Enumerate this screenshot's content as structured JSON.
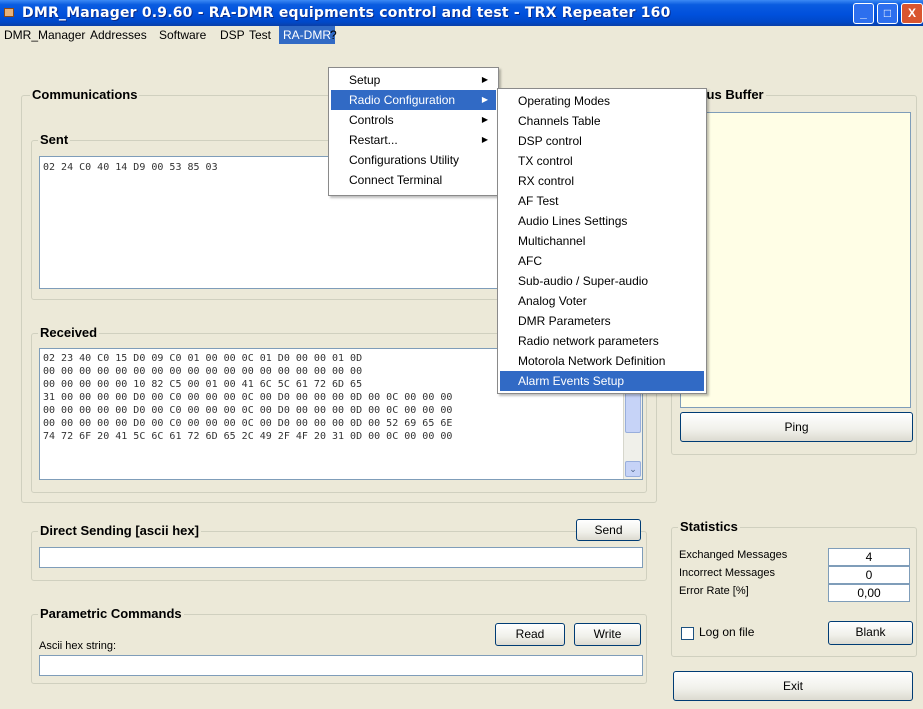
{
  "window": {
    "title": "DMR_Manager 0.9.60 - RA-DMR equipments control and test - TRX Repeater 160",
    "minimize_glyph": "_",
    "maximize_glyph": "□",
    "close_glyph": "X"
  },
  "menubar": {
    "items": [
      "DMR_Manager",
      "Addresses",
      "Software",
      "DSP",
      "Test",
      "RA-DMR",
      "?"
    ]
  },
  "radmr_menu": {
    "items": [
      "Setup",
      "Radio Configuration",
      "Controls",
      "Restart...",
      "Configurations Utility",
      "Connect Terminal"
    ],
    "arrow_glyph": "▶"
  },
  "radio_config_menu": {
    "items": [
      "Operating Modes",
      "Channels Table",
      "DSP control",
      "TX control",
      "RX control",
      "AF Test",
      "Audio Lines Settings",
      "Multichannel",
      "AFC",
      "Sub-audio / Super-audio",
      "Analog Voter",
      "DMR Parameters",
      "Radio network parameters",
      "Motorola Network Definition",
      "Alarm Events Setup"
    ]
  },
  "communications": {
    "title": "Communications",
    "sent_title": "Sent",
    "sent_text": "02 24 C0 40 14 D9 00 53 85 03",
    "received_title": "Received",
    "received_lines": [
      "02 23 40 C0 15 D0 09 C0 01 00 00 0C 01 D0 00 00 01 0D",
      "00 00 00 00 00 00 00 00 00 00 00 00 00 00 00 00 00 00",
      "00 00 00 00 00 10 82 C5 00 01 00 41 6C 5C 61 72 6D 65",
      "31 00 00 00 00 D0 00 C0 00 00 00 0C 00 D0 00 00 00 0D 00 0C 00 00 00",
      "00 00 00 00 00 D0 00 C0 00 00 00 0C 00 D0 00 00 00 0D 00 0C 00 00 00",
      "00 00 00 00 00 D0 00 C0 00 00 00 0C 00 D0 00 00 00 0D 00 52 69 65 6E",
      "74 72 6F 20 41 5C 6C 61 72 6D 65 2C 49 2F 4F 20 31 0D 00 0C 00 00 00"
    ],
    "scroll_down_glyph": "⌄"
  },
  "status_buffer": {
    "title": "Status Buffer",
    "ping_label": "Ping"
  },
  "direct_sending": {
    "title": "Direct Sending [ascii hex]",
    "send_label": "Send",
    "value": ""
  },
  "parametric": {
    "title": "Parametric Commands",
    "label": "Ascii hex string:",
    "read_label": "Read",
    "write_label": "Write",
    "value": ""
  },
  "statistics": {
    "title": "Statistics",
    "exchanged_label": "Exchanged Messages",
    "exchanged_value": "4",
    "incorrect_label": "Incorrect Messages",
    "incorrect_value": "0",
    "error_label": "Error Rate [%]",
    "error_value": "0,00",
    "log_label": "Log on file",
    "log_checked": false,
    "blank_label": "Blank"
  },
  "exit_label": "Exit",
  "colors": {
    "titlebar": "#0050dc",
    "menu_highlight": "#316ac5",
    "window_bg": "#ece9d8",
    "buffer_bg": "#fffee6"
  }
}
